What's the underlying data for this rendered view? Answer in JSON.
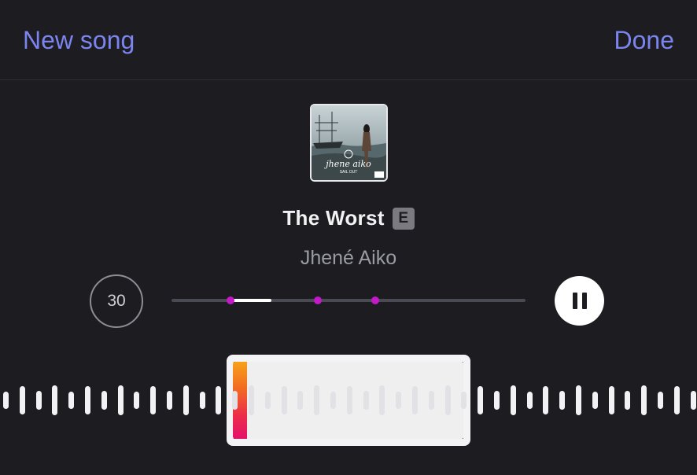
{
  "header": {
    "left_label": "New song",
    "right_label": "Done"
  },
  "song": {
    "title": "The Worst",
    "explicit_badge": "E",
    "artist": "Jhené Aiko"
  },
  "album_art": {
    "cover_text": "jhene aiko",
    "cover_subtext": "SAIL OUT"
  },
  "controls": {
    "duration_label": "30",
    "pause_icon": "pause-icon"
  },
  "colors": {
    "accent": "#7c84f0",
    "marker": "#c319c9",
    "background": "#1c1c21"
  }
}
